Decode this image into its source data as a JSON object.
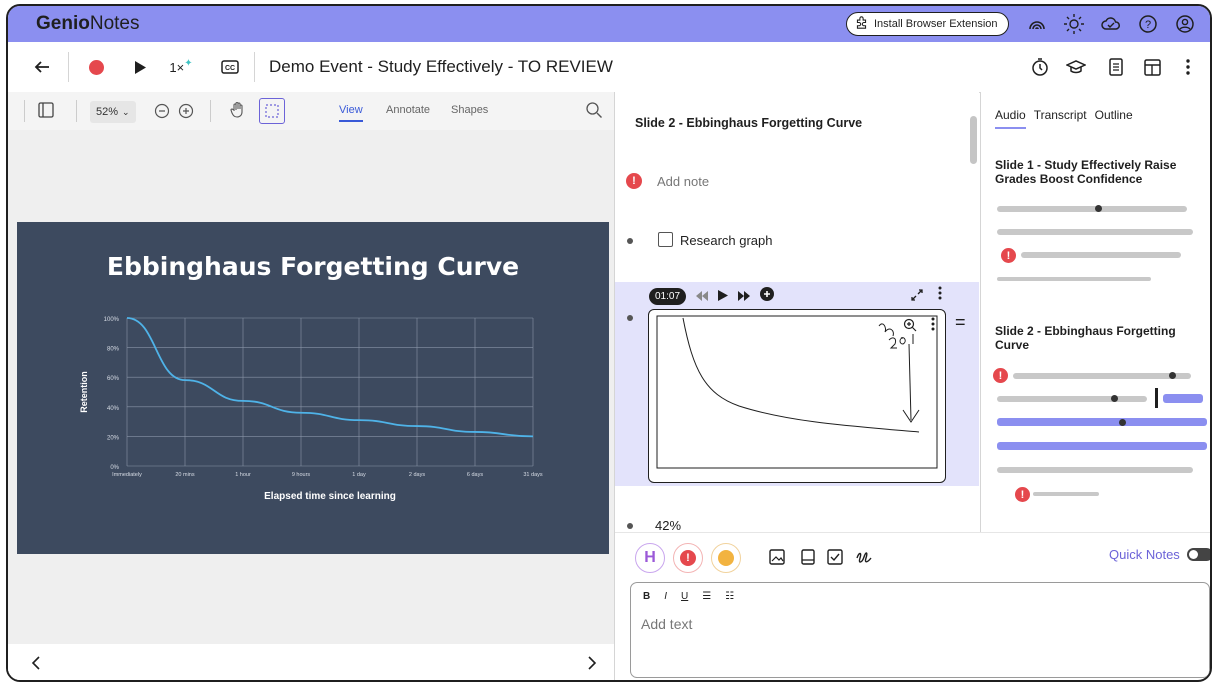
{
  "app": {
    "brand_bold": "Genio",
    "brand_rest": "Notes"
  },
  "topbar": {
    "extension_label": "Install Browser Extension"
  },
  "toolbar": {
    "speed": "1×",
    "title": "Demo Event - Study Effectively - TO REVIEW"
  },
  "viewer": {
    "zoom": "52%",
    "modes": [
      "View",
      "Annotate",
      "Shapes"
    ],
    "active_mode": "View"
  },
  "slide": {
    "title": "Ebbinghaus Forgetting Curve",
    "chart_data": {
      "type": "line",
      "title": "Ebbinghaus Forgetting Curve",
      "xlabel": "Elapsed time since learning",
      "ylabel": "Retention",
      "categories": [
        "Immediately",
        "20 mins",
        "1 hour",
        "9 hours",
        "1 day",
        "2 days",
        "6 days",
        "31 days"
      ],
      "y_ticks": [
        "0%",
        "20%",
        "40%",
        "60%",
        "80%",
        "100%"
      ],
      "ylim": [
        0,
        100
      ],
      "series": [
        {
          "values": [
            100,
            58,
            44,
            36,
            31,
            27,
            23,
            20
          ]
        }
      ],
      "grid": true,
      "line_color": "#4fb3e8"
    }
  },
  "notes": {
    "slide_heading": "Slide 2 - Ebbinghaus Forgetting Curve",
    "add_note": "Add note",
    "checkbox_label": "Research graph",
    "player_time": "01:07",
    "percent_note": "42%"
  },
  "editor": {
    "quick_notes_label": "Quick Notes",
    "placeholder": "Add text",
    "format_buttons": [
      "B",
      "I",
      "U",
      "☰",
      "☷"
    ],
    "highlight_label": "H"
  },
  "right_panel": {
    "tabs": [
      "Audio",
      "Transcript",
      "Outline"
    ],
    "active_tab": "Audio",
    "slide1_heading": "Slide 1 - Study Effectively Raise Grades Boost Confidence",
    "slide2_heading": "Slide 2 - Ebbinghaus Forgetting Curve"
  },
  "colors": {
    "accent": "#8b8ff0",
    "alert": "#e5484d",
    "slide_bg": "#3d4a5f"
  }
}
